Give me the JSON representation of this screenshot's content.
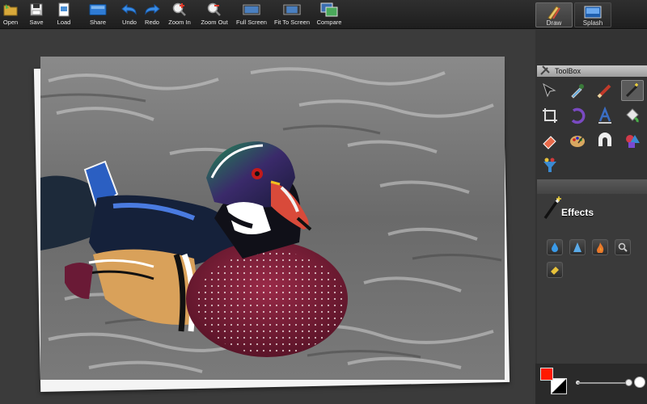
{
  "toolbar": {
    "open": "Open",
    "save": "Save",
    "load": "Load",
    "share": "Share",
    "undo": "Undo",
    "redo": "Redo",
    "zoom_in": "Zoom In",
    "zoom_out": "Zoom Out",
    "full_screen": "Full Screen",
    "fit_to_screen": "Fit To Screen",
    "compare": "Compare"
  },
  "modes": {
    "draw": "Draw",
    "splash": "Splash",
    "active": "Draw"
  },
  "toolbox": {
    "title": "ToolBox",
    "tools": [
      "pointer-tool",
      "eyedropper-tool",
      "brush-tool",
      "magic-wand-tool",
      "crop-tool",
      "rotate-tool",
      "text-tool",
      "fill-bucket-tool",
      "eraser-tool",
      "palette-tool",
      "shape-tool",
      "color-shapes-tool",
      "filter-tool"
    ],
    "selected_tool": "magic-wand-tool"
  },
  "effects": {
    "title": "Effects",
    "buttons": [
      "blur-drop-icon",
      "sharpen-icon",
      "burn-icon",
      "zoom-lens-icon",
      "smudge-icon"
    ]
  },
  "colors": {
    "foreground": "#ff1a00",
    "background": "#ffffff",
    "accent": "#4a8fd6"
  },
  "brush_size_level": 0.95
}
